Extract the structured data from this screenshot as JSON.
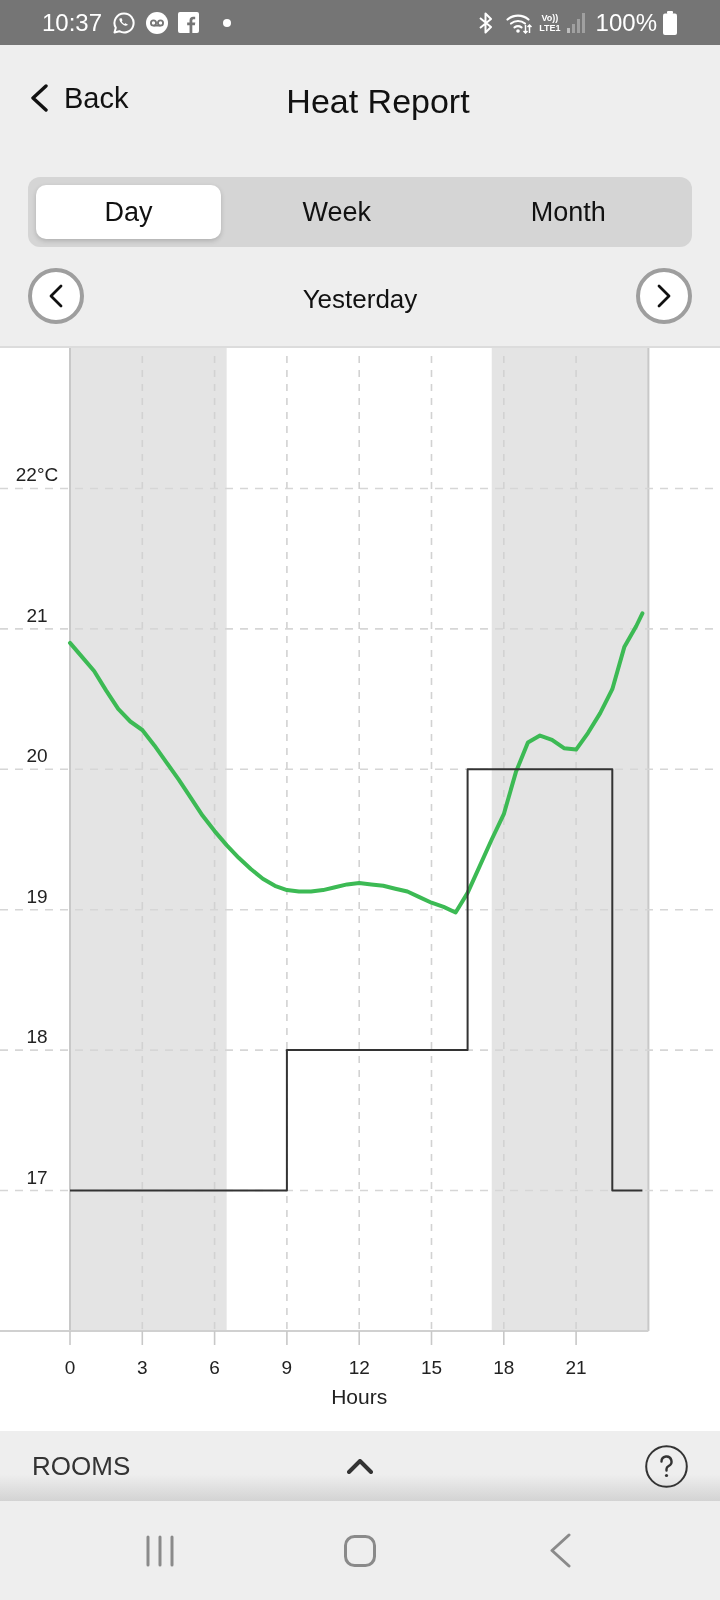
{
  "status_bar": {
    "time": "10:37",
    "network": [
      "Vo))",
      "LTE1"
    ],
    "battery": "100%"
  },
  "header": {
    "back": "Back",
    "title": "Heat Report"
  },
  "tabs": [
    {
      "label": "Day",
      "selected": true
    },
    {
      "label": "Week",
      "selected": false
    },
    {
      "label": "Month",
      "selected": false
    }
  ],
  "period": {
    "label": "Yesterday"
  },
  "chart": {
    "chart_data": {
      "type": "line",
      "xlabel": "Hours",
      "x": [
        0,
        0.5,
        1,
        1.5,
        2,
        2.5,
        3,
        3.5,
        4,
        4.5,
        5,
        5.5,
        6,
        6.5,
        7,
        7.5,
        8,
        8.5,
        9,
        9,
        9.5,
        10,
        10.5,
        11,
        11.5,
        12,
        12.5,
        13,
        13.5,
        14,
        14.5,
        15,
        15.5,
        16,
        16.5,
        16.5,
        17,
        17.5,
        18,
        18.5,
        19,
        19.5,
        20,
        20.5,
        21,
        21.5,
        22,
        22.5,
        22.5,
        23,
        23.5,
        23.75
      ],
      "series": [
        {
          "color": "#3cba54",
          "values": [
            20.9,
            20.8,
            20.7,
            20.56,
            20.43,
            20.34,
            20.28,
            20.17,
            20.05,
            19.93,
            19.8,
            19.67,
            19.56,
            19.46,
            19.37,
            19.29,
            19.22,
            19.17,
            19.14,
            19.14,
            19.13,
            19.13,
            19.14,
            19.16,
            19.18,
            19.19,
            19.18,
            19.17,
            19.15,
            19.13,
            19.09,
            19.05,
            19.02,
            18.98,
            19.12,
            19.12,
            19.31,
            19.5,
            19.68,
            19.98,
            20.19,
            20.24,
            20.21,
            20.15,
            20.14,
            20.26,
            20.4,
            20.57,
            20.57,
            20.87,
            21.02,
            21.11
          ]
        },
        {
          "color": "#333333",
          "values": [
            17,
            17,
            17,
            17,
            17,
            17,
            17,
            17,
            17,
            17,
            17,
            17,
            17,
            17,
            17,
            17,
            17,
            17,
            17,
            18,
            18,
            18,
            18,
            18,
            18,
            18,
            18,
            18,
            18,
            18,
            18,
            18,
            18,
            18,
            18,
            20,
            20,
            20,
            20,
            20,
            20,
            20,
            20,
            20,
            20,
            20,
            20,
            20,
            17,
            17,
            17,
            17
          ]
        }
      ],
      "xlim": [
        0,
        24
      ],
      "ylim": [
        16,
        23
      ],
      "xticks": [
        0,
        3,
        6,
        9,
        12,
        15,
        18,
        21
      ],
      "yticks": [
        17,
        18,
        19,
        20,
        21,
        {
          "value": 22,
          "label": "22°C"
        }
      ],
      "grid": true,
      "bands": [
        {
          "axis": "x",
          "from": 0,
          "to": 6.5
        },
        {
          "axis": "x",
          "from": 17.5,
          "to": 24
        }
      ]
    }
  },
  "rooms": {
    "label": "ROOMS",
    "expanded": false
  }
}
